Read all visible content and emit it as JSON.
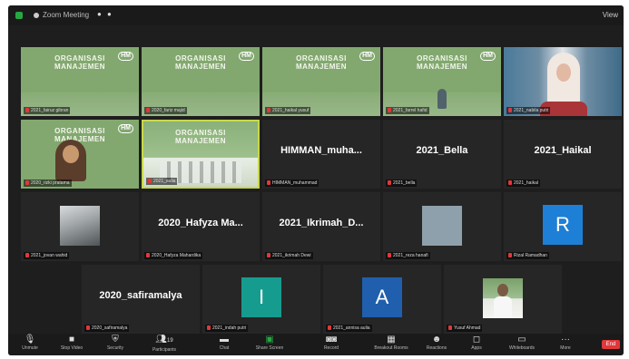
{
  "window": {
    "title": "Zoom Meeting",
    "view_label": "View",
    "accent_color": "#27a744",
    "active_speaker_color": "#c7d84a"
  },
  "slide": {
    "heading_line1": "ORGANISASI",
    "heading_line2": "MANAJEMEN",
    "badge": "HM"
  },
  "participants": [
    {
      "name": "2021_fairuz gibran",
      "video": "slide"
    },
    {
      "name": "2020_fariz majid",
      "video": "slide"
    },
    {
      "name": "2021_haikal yusuf",
      "video": "slide"
    },
    {
      "name": "2021_farrel hafid",
      "video": "slide"
    },
    {
      "name": "2021_nabila putri",
      "video": "camera"
    },
    {
      "name": "2020_rizki pratama",
      "video": "slide-person"
    },
    {
      "name": "2021_aulia",
      "video": "slide-group",
      "active": true
    },
    {
      "name": "HIMMAN_muhammad",
      "display": "HIMMAN_muha...",
      "video": "off"
    },
    {
      "name": "2021_bella",
      "display": "2021_Bella",
      "video": "off"
    },
    {
      "name": "2021_haikal",
      "display": "2021_Haikal",
      "video": "off"
    },
    {
      "name": "2021_jovan wahid",
      "video": "photo"
    },
    {
      "name": "2020_Hafyza Mahardika",
      "display": "2020_Hafyza Ma...",
      "video": "off"
    },
    {
      "name": "2021_ikrimah Dewi",
      "display": "2021_Ikrimah_D...",
      "video": "off"
    },
    {
      "name": "2021_reza hanafi",
      "video": "grey"
    },
    {
      "name": "Rizal Ramadhan",
      "video": "avatar",
      "letter": "R",
      "color": "#1e7fd6"
    },
    {
      "name": "2020_safiramalya",
      "display": "2020_safiramalya",
      "video": "off"
    },
    {
      "name": "2021_indah putri",
      "video": "avatar",
      "letter": "I",
      "color": "#169c8f"
    },
    {
      "name": "2021_annisa aulia",
      "video": "avatar",
      "letter": "A",
      "color": "#1f5fad"
    },
    {
      "name": "Yusuf Ahmad",
      "video": "person"
    }
  ],
  "toolbar": {
    "unmute": "Unmute",
    "stop_video": "Stop Video",
    "security": "Security",
    "participants": "Participants",
    "participant_count": "19",
    "chat": "Chat",
    "share_screen": "Share Screen",
    "record": "Record",
    "breakout": "Breakout Rooms",
    "reactions": "Reactions",
    "apps": "Apps",
    "whiteboards": "Whiteboards",
    "more": "More",
    "end": "End"
  }
}
